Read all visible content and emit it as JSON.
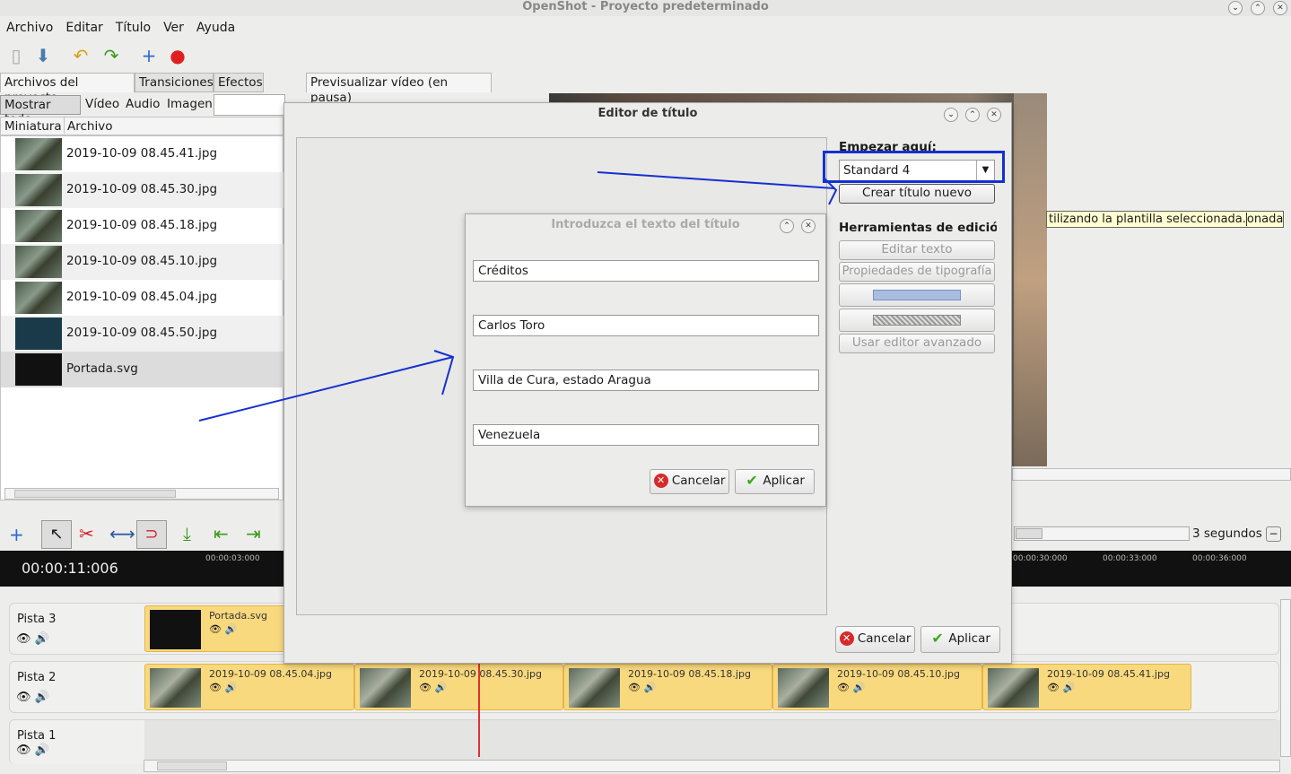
{
  "app": {
    "title": "OpenShot - Proyecto predeterminado"
  },
  "menu": [
    "Archivo",
    "Editar",
    "Título",
    "Ver",
    "Ayuda"
  ],
  "tabs": {
    "files": "Archivos del proyecto",
    "transitions": "Transiciones",
    "effects": "Efectos",
    "preview": "Previsualizar vídeo (en pausa)"
  },
  "filters": {
    "all": "Mostrar todo",
    "video": "Vídeo",
    "audio": "Audio",
    "image": "Imagen"
  },
  "columns": {
    "thumb": "Miniatura",
    "file": "Archivo"
  },
  "files": [
    "2019-10-09 08.45.41.jpg",
    "2019-10-09 08.45.30.jpg",
    "2019-10-09 08.45.18.jpg",
    "2019-10-09 08.45.10.jpg",
    "2019-10-09 08.45.04.jpg",
    "2019-10-09 08.45.50.jpg",
    "Portada.svg"
  ],
  "title_editor": {
    "title": "Editor de título",
    "start_here": "Empezar aquí:",
    "template": "Standard 4",
    "create_new": "Crear título nuevo",
    "tools_heading": "Herramientas de edición",
    "edit_text": "Editar texto",
    "font_props": "Propiedades de tipografía",
    "advanced": "Usar editor avanzado",
    "cancel": "Cancelar",
    "apply": "Aplicar"
  },
  "text_dialog": {
    "title": "Introduzca el texto del título",
    "fields": [
      "Créditos",
      "Carlos Toro",
      "Villa de Cura, estado Aragua",
      "Venezuela"
    ],
    "cancel": "Cancelar",
    "apply": "Aplicar"
  },
  "tooltip": "tilizando la plantilla seleccionada.",
  "tooltip_tail": "onada.",
  "timeline": {
    "timecode": "00:00:11:006",
    "zoom_label": "3 segundos",
    "ticks": [
      "00:00:03:000",
      "00:00:30:000",
      "00:00:33:000",
      "00:00:36:000"
    ],
    "tracks": [
      {
        "name": "Pista 3",
        "clips": [
          "Portada.svg"
        ]
      },
      {
        "name": "Pista 2",
        "clips": [
          "2019-10-09 08.45.04.jpg",
          "2019-10-09 08.45.30.jpg",
          "2019-10-09 08.45.18.jpg",
          "2019-10-09 08.45.10.jpg",
          "2019-10-09 08.45.41.jpg"
        ]
      },
      {
        "name": "Pista 1",
        "clips": []
      }
    ]
  },
  "colors": {
    "annotation": "#1530d0",
    "playhead": "#e03030",
    "clip": "#f9d97e"
  }
}
